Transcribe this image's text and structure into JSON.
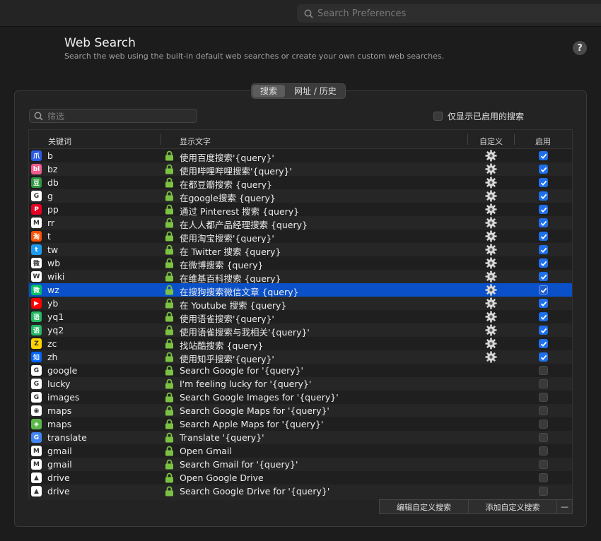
{
  "titlebar": {
    "search_placeholder": "Search Preferences"
  },
  "header": {
    "title": "Web Search",
    "subtitle": "Search the web using the built-in default web searches or create your own custom web searches.",
    "help_label": "?"
  },
  "tabs": {
    "search": "搜索",
    "url_history": "网址 / 历史",
    "active": "搜索"
  },
  "filter": {
    "placeholder": "筛选"
  },
  "only_enabled": {
    "label": "仅显示已启用的搜索",
    "checked": false
  },
  "columns": {
    "keyword": "关键词",
    "display": "显示文字",
    "custom": "自定义",
    "enabled": "启用"
  },
  "rows": [
    {
      "icon": "baidu-icon",
      "color": "#2b5ce6",
      "glyph": "爪",
      "keyword": "b",
      "text": "使用百度搜索'{query}'",
      "custom": true,
      "enabled": true
    },
    {
      "icon": "bilibili-icon",
      "color": "#f25d8e",
      "glyph": "bl",
      "keyword": "bz",
      "text": "使用哔哩哔哩搜索'{query}'",
      "custom": true,
      "enabled": true
    },
    {
      "icon": "douban-icon",
      "color": "#2e963d",
      "glyph": "豆",
      "keyword": "db",
      "text": "在都豆瓣搜索 {query}",
      "custom": true,
      "enabled": true
    },
    {
      "icon": "google-icon",
      "color": "#ffffff",
      "glyph": "G",
      "keyword": "g",
      "text": "在google搜索 {query}",
      "custom": true,
      "enabled": true
    },
    {
      "icon": "pinterest-icon",
      "color": "#e60023",
      "glyph": "P",
      "keyword": "pp",
      "text": "通过 Pinterest 搜索 {query}",
      "custom": true,
      "enabled": true
    },
    {
      "icon": "woshipm-icon",
      "color": "#ffffff",
      "glyph": "M",
      "keyword": "rr",
      "text": "在人人都产品经理搜索 {query}",
      "custom": true,
      "enabled": true
    },
    {
      "icon": "taobao-icon",
      "color": "#ff5000",
      "glyph": "淘",
      "keyword": "t",
      "text": "使用淘宝搜索'{query}'",
      "custom": true,
      "enabled": true
    },
    {
      "icon": "twitter-icon",
      "color": "#1d9bf0",
      "glyph": "t",
      "keyword": "tw",
      "text": "在 Twitter 搜索 {query}",
      "custom": true,
      "enabled": true
    },
    {
      "icon": "weibo-icon",
      "color": "#ffffff",
      "glyph": "微",
      "keyword": "wb",
      "text": "在微博搜索 {query}",
      "custom": true,
      "enabled": true
    },
    {
      "icon": "wikipedia-icon",
      "color": "#ffffff",
      "glyph": "W",
      "keyword": "wiki",
      "text": "在维基百科搜索 {query}",
      "custom": true,
      "enabled": true
    },
    {
      "icon": "wechat-icon",
      "color": "#07c160",
      "glyph": "微",
      "keyword": "wz",
      "text": "在搜狗搜索微信文章 {query}",
      "custom": true,
      "enabled": true,
      "selected": true
    },
    {
      "icon": "youtube-icon",
      "color": "#ff0000",
      "glyph": "▶",
      "keyword": "yb",
      "text": "在 Youtube 搜索 {query}",
      "custom": true,
      "enabled": true
    },
    {
      "icon": "yuque-icon",
      "color": "#25b864",
      "glyph": "语",
      "keyword": "yq1",
      "text": "使用语雀搜索'{query}'",
      "custom": true,
      "enabled": true
    },
    {
      "icon": "yuque-icon",
      "color": "#25b864",
      "glyph": "语",
      "keyword": "yq2",
      "text": "使用语雀搜索与我相关'{query}'",
      "custom": true,
      "enabled": true
    },
    {
      "icon": "zhanku-icon",
      "color": "#ffd400",
      "glyph": "Z",
      "keyword": "zc",
      "text": "找站酷搜索 {query}",
      "custom": true,
      "enabled": true
    },
    {
      "icon": "zhihu-icon",
      "color": "#0066ff",
      "glyph": "知",
      "keyword": "zh",
      "text": "使用知乎搜索'{query}'",
      "custom": true,
      "enabled": true
    },
    {
      "icon": "google-icon",
      "color": "#ffffff",
      "glyph": "G",
      "keyword": "google",
      "text": "Search Google for '{query}'",
      "custom": false,
      "enabled": false
    },
    {
      "icon": "google-icon",
      "color": "#ffffff",
      "glyph": "G",
      "keyword": "lucky",
      "text": "I'm feeling lucky for '{query}'",
      "custom": false,
      "enabled": false
    },
    {
      "icon": "google-icon",
      "color": "#ffffff",
      "glyph": "G",
      "keyword": "images",
      "text": "Search Google Images for '{query}'",
      "custom": false,
      "enabled": false
    },
    {
      "icon": "google-maps-icon",
      "color": "#ffffff",
      "glyph": "◉",
      "keyword": "maps",
      "text": "Search Google Maps for '{query}'",
      "custom": false,
      "enabled": false
    },
    {
      "icon": "apple-maps-icon",
      "color": "#5ab84a",
      "glyph": "◈",
      "keyword": "maps",
      "text": "Search Apple Maps for '{query}'",
      "custom": false,
      "enabled": false
    },
    {
      "icon": "google-translate-icon",
      "color": "#4285f4",
      "glyph": "G",
      "keyword": "translate",
      "text": "Translate '{query}'",
      "custom": false,
      "enabled": false
    },
    {
      "icon": "gmail-icon",
      "color": "#ffffff",
      "glyph": "M",
      "keyword": "gmail",
      "text": "Open Gmail",
      "custom": false,
      "enabled": false
    },
    {
      "icon": "gmail-icon",
      "color": "#ffffff",
      "glyph": "M",
      "keyword": "gmail",
      "text": "Search Gmail for '{query}'",
      "custom": false,
      "enabled": false
    },
    {
      "icon": "google-drive-icon",
      "color": "#ffffff",
      "glyph": "▲",
      "keyword": "drive",
      "text": "Open Google Drive",
      "custom": false,
      "enabled": false
    },
    {
      "icon": "google-drive-icon",
      "color": "#ffffff",
      "glyph": "▲",
      "keyword": "drive",
      "text": "Search Google Drive for '{query}'",
      "custom": false,
      "enabled": false
    }
  ],
  "buttons": {
    "edit": "编辑自定义搜索",
    "add": "添加自定义搜索",
    "remove": "—"
  },
  "colors": {
    "accent": "#0a50c8",
    "lock": "#7cc242"
  }
}
